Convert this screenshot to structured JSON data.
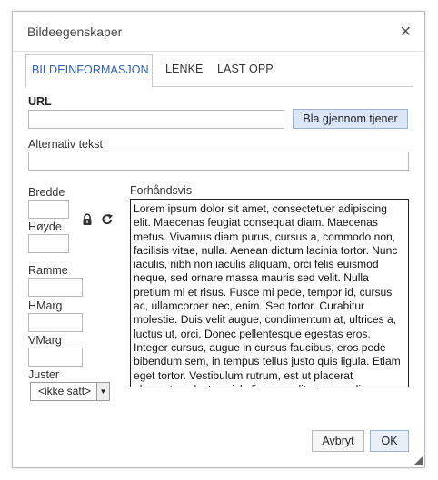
{
  "dialog": {
    "title": "Bildeegenskaper",
    "close_glyph": "✕"
  },
  "tabs": [
    {
      "label": "BILDEINFORMASJON",
      "active": true
    },
    {
      "label": "LENKE",
      "active": false
    },
    {
      "label": "LAST OPP",
      "active": false
    }
  ],
  "form": {
    "url_label": "URL",
    "url_value": "",
    "browse_label": "Bla gjennom tjener",
    "alt_label": "Alternativ tekst",
    "alt_value": "",
    "width_label": "Bredde",
    "width_value": "",
    "height_label": "Høyde",
    "height_value": "",
    "border_label": "Ramme",
    "border_value": "",
    "hspace_label": "HMarg",
    "hspace_value": "",
    "vspace_label": "VMarg",
    "vspace_value": "",
    "align_label": "Juster",
    "align_selected": "<ikke satt>",
    "preview_label": "Forhåndsvis",
    "preview_text": "Lorem ipsum dolor sit amet, consectetuer adipiscing elit. Maecenas feugiat consequat diam. Maecenas metus. Vivamus diam purus, cursus a, commodo non, facilisis vitae, nulla. Aenean dictum lacinia tortor. Nunc iaculis, nibh non iaculis aliquam, orci felis euismod neque, sed ornare massa mauris sed velit. Nulla pretium mi et risus. Fusce mi pede, tempor id, cursus ac, ullamcorper nec, enim. Sed tortor. Curabitur molestie. Duis velit augue, condimentum at, ultrices a, luctus ut, orci. Donec pellentesque egestas eros. Integer cursus, augue in cursus faucibus, eros pede bibendum sem, in tempus tellus justo quis ligula. Etiam eget tortor. Vestibulum rutrum, est ut placerat elementum, lectus nisl aliquam velit, tempor aliquam eros nunc nonummy metus. In"
  },
  "footer": {
    "cancel_label": "Avbryt",
    "ok_label": "OK"
  },
  "colors": {
    "accent": "#2a5db0",
    "button_bg": "#dbe6f6"
  },
  "icons": {
    "lock": "lock-icon",
    "reset": "reset-icon",
    "close": "close-icon",
    "resize": "resize-grip-icon"
  }
}
